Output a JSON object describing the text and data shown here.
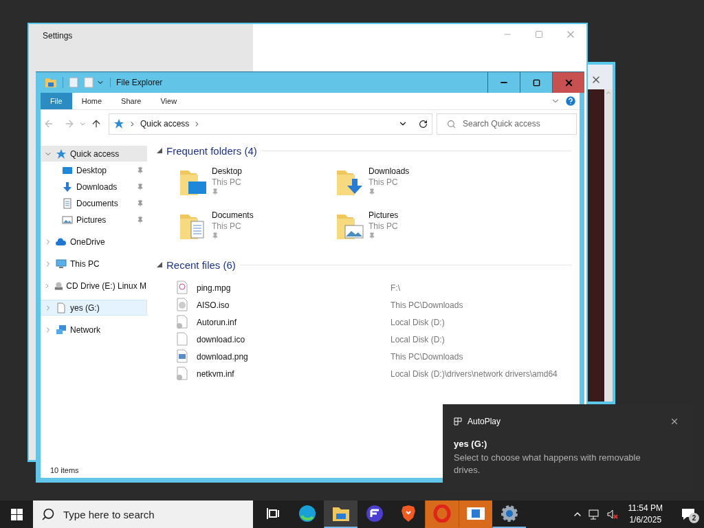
{
  "settings_window": {
    "title": "Settings"
  },
  "explorer": {
    "title": "File Explorer",
    "ribbon_tabs": [
      {
        "label": "File",
        "selected": true
      },
      {
        "label": "Home",
        "selected": false
      },
      {
        "label": "Share",
        "selected": false
      },
      {
        "label": "View",
        "selected": false
      }
    ],
    "address": {
      "path": "Quick access"
    },
    "search": {
      "placeholder": "Search Quick access"
    },
    "nav": [
      {
        "label": "Quick access",
        "kind": "star",
        "expanded": true,
        "selected": true,
        "hovered": false,
        "children": [
          {
            "label": "Desktop",
            "kind": "desktop",
            "pinned": true
          },
          {
            "label": "Downloads",
            "kind": "downloads",
            "pinned": true
          },
          {
            "label": "Documents",
            "kind": "documents",
            "pinned": true
          },
          {
            "label": "Pictures",
            "kind": "pictures",
            "pinned": true
          }
        ]
      },
      {
        "label": "OneDrive",
        "kind": "cloud",
        "expanded": false,
        "selected": false,
        "hovered": false
      },
      {
        "label": "This PC",
        "kind": "pc",
        "expanded": false,
        "selected": false,
        "hovered": false
      },
      {
        "label": "CD Drive (E:) Linux M",
        "kind": "cd",
        "expanded": false,
        "selected": false,
        "hovered": false
      },
      {
        "label": "yes (G:)",
        "kind": "file",
        "expanded": false,
        "selected": false,
        "hovered": true
      },
      {
        "label": "Network",
        "kind": "network",
        "expanded": false,
        "selected": false,
        "hovered": false
      }
    ],
    "frequent_folders": {
      "title": "Frequent folders (4)",
      "expanded": true,
      "items": [
        {
          "name": "Desktop",
          "location": "This PC",
          "kind": "desktop",
          "pinned": true
        },
        {
          "name": "Downloads",
          "location": "This PC",
          "kind": "downloads",
          "pinned": true
        },
        {
          "name": "Documents",
          "location": "This PC",
          "kind": "documents",
          "pinned": true
        },
        {
          "name": "Pictures",
          "location": "This PC",
          "kind": "pictures",
          "pinned": true
        }
      ]
    },
    "recent_files": {
      "title": "Recent files (6)",
      "expanded": true,
      "items": [
        {
          "name": "ping.mpg",
          "path": "F:\\",
          "kind": "video"
        },
        {
          "name": "AISO.iso",
          "path": "This PC\\Downloads",
          "kind": "disc"
        },
        {
          "name": "Autorun.inf",
          "path": "Local Disk (D:)",
          "kind": "config"
        },
        {
          "name": "download.ico",
          "path": "Local Disk (D:)",
          "kind": "blank"
        },
        {
          "name": "download.png",
          "path": "This PC\\Downloads",
          "kind": "image"
        },
        {
          "name": "netkvm.inf",
          "path": "Local Disk (D:)\\drivers\\network drivers\\amd64",
          "kind": "config"
        }
      ]
    },
    "status": "10 items"
  },
  "toast": {
    "app": "AutoPlay",
    "title": "yes (G:)",
    "message": "Select to choose what happens with removable drives."
  },
  "taskbar": {
    "search_placeholder": "Type here to search",
    "apps": [
      {
        "kind": "task-view",
        "selected": false,
        "running": false,
        "flashing": false
      },
      {
        "kind": "edge",
        "selected": false,
        "running": false,
        "flashing": false
      },
      {
        "kind": "explorer",
        "selected": true,
        "running": true,
        "flashing": false
      },
      {
        "kind": "letter-app",
        "selected": false,
        "running": false,
        "flashing": false
      },
      {
        "kind": "brave",
        "selected": false,
        "running": false,
        "flashing": false
      },
      {
        "kind": "opera",
        "selected": false,
        "running": false,
        "flashing": true
      },
      {
        "kind": "window-app",
        "selected": false,
        "running": false,
        "flashing": true
      },
      {
        "kind": "settings",
        "selected": false,
        "running": true,
        "flashing": false
      }
    ],
    "time": "11:54 PM",
    "date": "1/6/2025",
    "notifications": "2"
  }
}
